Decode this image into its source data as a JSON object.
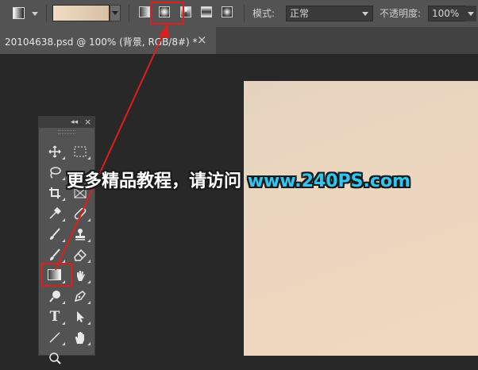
{
  "options_bar": {
    "mode_label": "模式:",
    "mode_value": "正常",
    "opacity_label": "不透明度:",
    "opacity_value": "100%",
    "gradient_swatch_colors": [
      "#f0dcc4",
      "#d8c0a4"
    ],
    "gradient_types": [
      "linear-gradient",
      "radial-gradient",
      "angle-gradient",
      "reflected-gradient",
      "diamond-gradient"
    ],
    "selected_gradient_type": "radial-gradient"
  },
  "document_tab": {
    "title": "20104638.psd @ 100% (背景, RGB/8#) *",
    "close_glyph": "×"
  },
  "tools_panel": {
    "header_collapse": "◂◂",
    "header_close": "×",
    "rows": [
      [
        "move-tool",
        "marquee-tool"
      ],
      [
        "lasso-tool",
        "quick-selection-tool"
      ],
      [
        "crop-tool",
        "frame-tool"
      ],
      [
        "eyedropper-tool",
        "healing-brush-tool"
      ],
      [
        "brush-tool",
        "clone-stamp-tool"
      ],
      [
        "history-brush-tool",
        "eraser-tool"
      ],
      [
        "gradient-tool",
        "smudge-tool"
      ],
      [
        "dodge-tool",
        "pen-tool"
      ],
      [
        "type-tool",
        "path-selection-tool"
      ],
      [
        "line-tool",
        "hand-tool"
      ],
      [
        "zoom-tool",
        ""
      ]
    ],
    "selected_tool": "gradient-tool",
    "type_glyph": "T"
  },
  "watermark": {
    "cn_text": "更多精品教程，请访问",
    "url_text": "www.240PS.com"
  },
  "colors": {
    "highlight_red": "#e11c1c",
    "watermark_blue": "#2fc6f0"
  }
}
